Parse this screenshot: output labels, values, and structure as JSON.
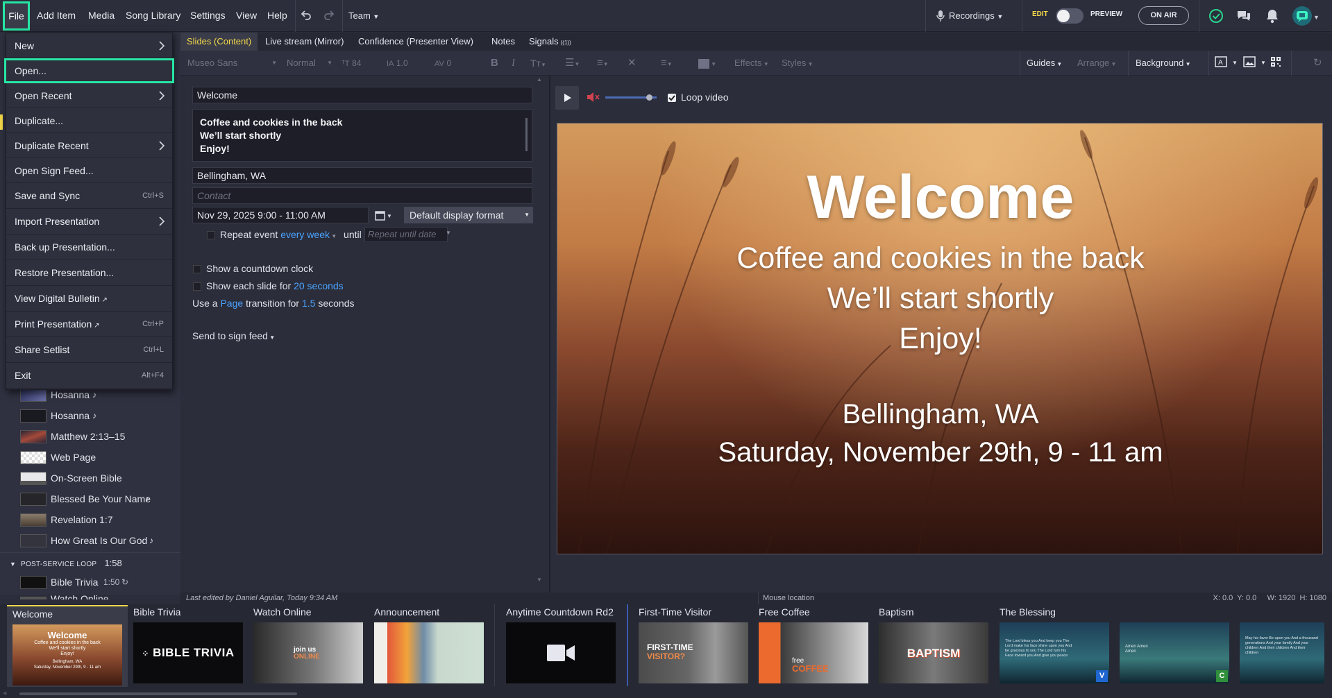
{
  "menubar": {
    "file": "File",
    "add_item": "Add Item",
    "media": "Media",
    "song_library": "Song Library",
    "settings": "Settings",
    "view": "View",
    "help": "Help",
    "team": "Team"
  },
  "topright": {
    "recordings": "Recordings",
    "edit": "EDIT",
    "preview": "PREVIEW",
    "on_air": "ON AIR"
  },
  "file_menu": [
    {
      "label": "New",
      "shortcut": "",
      "submenu": true
    },
    {
      "label": "Open...",
      "shortcut": "",
      "submenu": false
    },
    {
      "label": "Open Recent",
      "shortcut": "",
      "submenu": true
    },
    {
      "label": "Duplicate...",
      "shortcut": "",
      "submenu": false
    },
    {
      "label": "Duplicate Recent",
      "shortcut": "",
      "submenu": true
    },
    {
      "label": "Open Sign Feed...",
      "shortcut": "",
      "submenu": false
    },
    {
      "label": "Save and Sync",
      "shortcut": "Ctrl+S",
      "submenu": false
    },
    {
      "label": "Import Presentation",
      "shortcut": "",
      "submenu": true
    },
    {
      "label": "Back up Presentation...",
      "shortcut": "",
      "submenu": false
    },
    {
      "label": "Restore Presentation...",
      "shortcut": "",
      "submenu": false
    },
    {
      "label": "View Digital Bulletin",
      "shortcut": "",
      "submenu": false
    },
    {
      "label": "Print Presentation",
      "shortcut": "Ctrl+P",
      "submenu": false
    },
    {
      "label": "Share Setlist",
      "shortcut": "Ctrl+L",
      "submenu": false
    },
    {
      "label": "Exit",
      "shortcut": "Alt+F4",
      "submenu": false
    }
  ],
  "tabs": [
    "Slides (Content)",
    "Live stream (Mirror)",
    "Confidence (Presenter View)",
    "Notes",
    "Signals"
  ],
  "signals_badge": "((1))",
  "toolbar": {
    "font": "Museo Sans",
    "weight": "Normal",
    "size": "84",
    "line": "1.0",
    "spacing": "0",
    "effects": "Effects",
    "styles": "Styles",
    "guides": "Guides",
    "arrange": "Arrange",
    "background": "Background"
  },
  "setlist": {
    "items": [
      {
        "label": "Hosanna",
        "song": true
      },
      {
        "label": "Hosanna",
        "song": true
      },
      {
        "label": "Matthew 2:13–15",
        "song": false
      },
      {
        "label": "Web Page",
        "song": false
      },
      {
        "label": "On-Screen Bible",
        "song": false
      },
      {
        "label": "Blessed Be Your Name",
        "song": true
      },
      {
        "label": "Revelation 1:7",
        "song": false
      },
      {
        "label": "How Great Is Our God",
        "song": true
      }
    ],
    "section": "POST-SERVICE LOOP",
    "section_time": "1:58",
    "bible_trivia": "Bible Trivia",
    "bible_trivia_time": "1:50",
    "watch_online": "Watch Online"
  },
  "editor": {
    "title": "Welcome",
    "body_lines": [
      "Coffee and cookies in the back",
      "We’ll start shortly",
      "Enjoy!"
    ],
    "location": "Bellingham, WA",
    "contact_placeholder": "Contact",
    "datetime": "Nov 29, 2025 9:00 - 11:00 AM",
    "display_format": "Default display format",
    "repeat_label": "Repeat event",
    "repeat_value": "every week",
    "until": "until",
    "repeat_until_placeholder": "Repeat until date",
    "countdown": "Show a countdown clock",
    "each_slide_pre": "Show each slide for",
    "each_slide_val": "20 seconds",
    "use_a": "Use a",
    "transition": "Page",
    "transition_for": "transition for",
    "transition_val": "1.5",
    "seconds": "seconds",
    "send_to": "Send to sign feed"
  },
  "preview": {
    "loop_video": "Loop video",
    "volume": 0.85,
    "heading": "Welcome",
    "lines": [
      "Coffee and cookies in the back",
      "We’ll start shortly",
      "Enjoy!"
    ],
    "location": "Bellingham, WA",
    "date": "Saturday, November 29th, 9 - 11 am"
  },
  "status": {
    "last_edited": "Last edited by Daniel Aguilar, Today 9:34 AM",
    "mouse": "Mouse location",
    "coords": "X: 0.0  Y: 0.0     W: 1920  H: 1080"
  },
  "strip": [
    {
      "title": "Welcome"
    },
    {
      "title": "Bible Trivia"
    },
    {
      "title": "Watch Online"
    },
    {
      "title": "Announcement"
    },
    {
      "title": "Anytime Countdown Rd2"
    },
    {
      "title": "First-Time Visitor"
    },
    {
      "title": "Free Coffee"
    },
    {
      "title": "Baptism"
    },
    {
      "title": "The Blessing"
    }
  ],
  "strip_texts": {
    "welcome_mini": "Welcome",
    "welcome_mini_line1": "Coffee and cookies in the back",
    "welcome_mini_line2": "We'll start shortly",
    "welcome_mini_line3": "Enjoy!",
    "welcome_mini_loc": "Bellingham, WA",
    "welcome_mini_date": "Saturday, November 29th, 9 - 11 am",
    "bible_trivia": "BIBLE TRIVIA",
    "join_us": "join us",
    "online": "ONLINE",
    "first_time": "FIRST-TIME",
    "visitor": "VISITOR?",
    "free": "free",
    "coffee": "COFFEE",
    "baptism": "BAPTISM",
    "blessing_badges": [
      "V",
      "C"
    ],
    "blessing_v": "The Lord bless you And keep you The Lord make his face shine upon you And be gracious to you The Lord turn his Face toward you And give you peace",
    "blessing_c": "Amen Amen Amen",
    "blessing_3": "May his favor Be upon you And a thousand generations And your family And your children And their children And their children"
  }
}
